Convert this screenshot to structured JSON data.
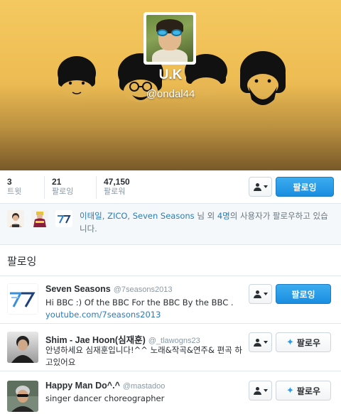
{
  "profile": {
    "name": "U.K",
    "handle": "@ondal44"
  },
  "stats": [
    {
      "value": "3",
      "label": "트윗"
    },
    {
      "value": "21",
      "label": "팔로잉"
    },
    {
      "value": "47,150",
      "label": "팔로워"
    }
  ],
  "profile_actions": {
    "following_label": "팔로잉"
  },
  "known_followers": {
    "names": [
      "이태일",
      "ZICO",
      "Seven Seasons"
    ],
    "sep1": ", ",
    "sep2": ", ",
    "text_mid": " 님 외 ",
    "count": "4명",
    "text_end": "의 사용자가 팔로우하고 있습니다."
  },
  "following_section": {
    "title": "팔로잉"
  },
  "users": [
    {
      "name": "Seven Seasons",
      "handle": "@7seasons2013",
      "bio": "Hi BBC :) Of the BBC For the BBC By the BBC . ",
      "bio_link": "youtube.com/7seasons2013",
      "button_label": "팔로잉"
    },
    {
      "name": "Shim - Jae Hoon(심재훈)",
      "handle": "@_tlawogns23",
      "bio": "안녕하세요 심재훈입니다!^^ 노래&작곡&연주& 편곡 하고있어요",
      "button_label": "팔로우"
    },
    {
      "name": "Happy Man Do^.^",
      "handle": "@mastadoo",
      "bio": "singer dancer choreographer",
      "button_label": "팔로우"
    }
  ],
  "colors": {
    "accent": "#1a8de0",
    "link": "#2b7bb9",
    "banner": "#eebd54"
  }
}
